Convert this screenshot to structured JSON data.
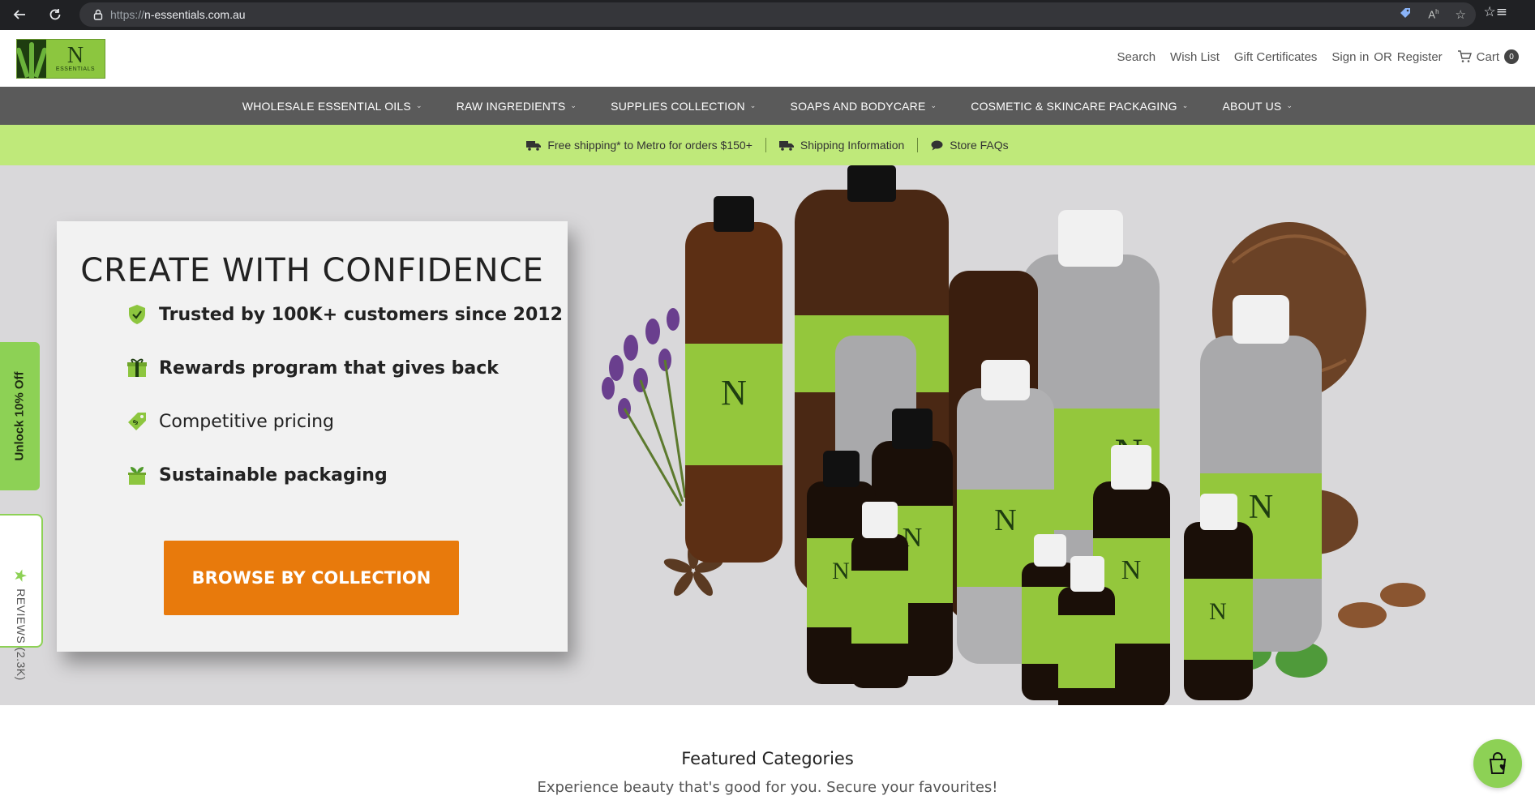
{
  "browser": {
    "url_scheme": "https://",
    "url_host": "n-essentials.com.au"
  },
  "header": {
    "logo_letter": "N",
    "logo_word": "ESSENTIALS",
    "links": {
      "search": "Search",
      "wishlist": "Wish List",
      "gift": "Gift Certificates",
      "signin": "Sign in",
      "or": "OR",
      "register": "Register",
      "cart": "Cart",
      "cart_count": "0"
    }
  },
  "nav": {
    "items": [
      {
        "label": "WHOLESALE ESSENTIAL OILS"
      },
      {
        "label": "RAW INGREDIENTS"
      },
      {
        "label": "SUPPLIES COLLECTION"
      },
      {
        "label": "SOAPS AND BODYCARE"
      },
      {
        "label": "COSMETIC & SKINCARE PACKAGING"
      },
      {
        "label": "ABOUT US"
      }
    ]
  },
  "infobar": {
    "shipping": "Free shipping* to Metro for orders $150+",
    "shipping_info": "Shipping Information",
    "faqs": "Store FAQs"
  },
  "hero": {
    "title": "CREATE WITH CONFIDENCE",
    "features": [
      {
        "text": "Trusted by 100K+ customers since 2012"
      },
      {
        "text": "Rewards program that gives back"
      },
      {
        "text": "Competitive pricing"
      },
      {
        "text": "Sustainable packaging"
      }
    ],
    "cta": "BROWSE BY COLLECTION"
  },
  "side_tabs": {
    "unlock": "Unlock 10% Off",
    "reviews": "REVIEWS (2.3K)"
  },
  "featured": {
    "title": "Featured Categories",
    "subtitle": "Experience beauty that's good for you. Secure your favourites!"
  },
  "colors": {
    "accent_green": "#8dd155",
    "infobar_green": "#bfe97a",
    "nav_grey": "#5a5a5a",
    "cta_orange": "#e87a0c"
  }
}
